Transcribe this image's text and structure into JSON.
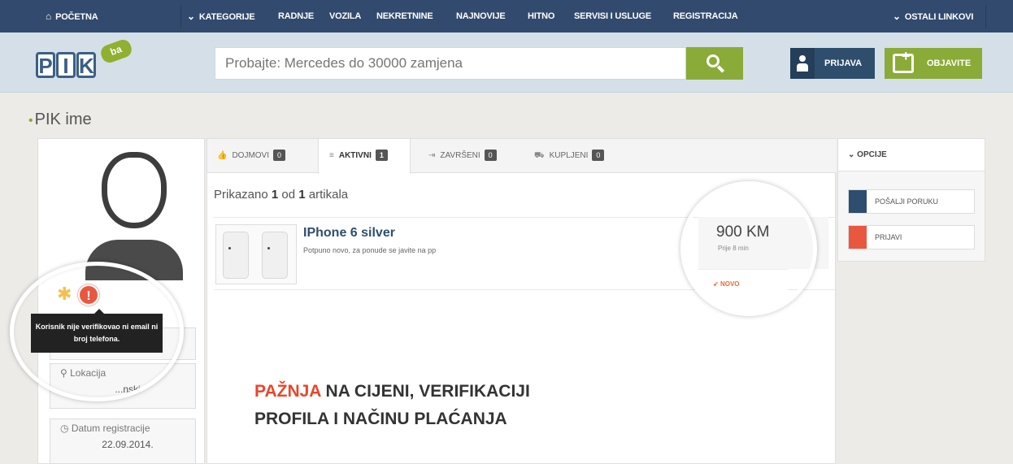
{
  "nav": {
    "home": "POČETNA",
    "items": [
      "KATEGORIJE",
      "RADNJE",
      "VOZILA",
      "NEKRETNINE",
      "NAJNOVIJE",
      "HITNO",
      "SERVISI I USLUGE",
      "REGISTRACIJA"
    ],
    "other_links": "OSTALI LINKOVI"
  },
  "header": {
    "logo_text": "PIK",
    "logo_badge": "ba",
    "search_placeholder": "Probajte: Mercedes do 30000 zamjena",
    "login_label": "PRIJAVA",
    "publish_label": "OBJAVITE"
  },
  "page": {
    "title": "PIK ime"
  },
  "profile": {
    "tooltip": "Korisnik nije verifikovao ni email ni broj telefona.",
    "location_label": "Lokacija",
    "location_value": "...nski",
    "registration_label": "Datum registracije",
    "registration_value": "22.09.2014."
  },
  "tabs": [
    {
      "label": "DOJMOVI",
      "count": "0",
      "icon": "thumbs-up-icon"
    },
    {
      "label": "AKTIVNI",
      "count": "1",
      "icon": "list-icon"
    },
    {
      "label": "ZAVRŠENI",
      "count": "0",
      "icon": "sign-out-icon"
    },
    {
      "label": "KUPLJENI",
      "count": "0",
      "icon": "cart-icon"
    }
  ],
  "listing": {
    "shown_prefix": "Prikazano",
    "shown_count": "1",
    "shown_mid": "od",
    "shown_total": "1",
    "shown_suffix": "artikala",
    "item": {
      "title": "IPhone 6 silver",
      "desc": "Potpuno novo, za ponude se javite na pp",
      "price": "900 KM",
      "time": "Prije 8 min",
      "condition": "NOVO"
    }
  },
  "warning": {
    "highlight": "PAŽNJA",
    "line1_rest": "NA CIJENI, VERIFIKACIJI",
    "line2": "PROFILA I NAČINU PLAĆANJA"
  },
  "options": {
    "header": "OPCIJE",
    "send_message": "POŠALJI PORUKU",
    "report": "PRIJAVI"
  },
  "colors": {
    "nav": "#324a6d",
    "accent_green": "#8aab37",
    "warning_red": "#e9452a"
  }
}
